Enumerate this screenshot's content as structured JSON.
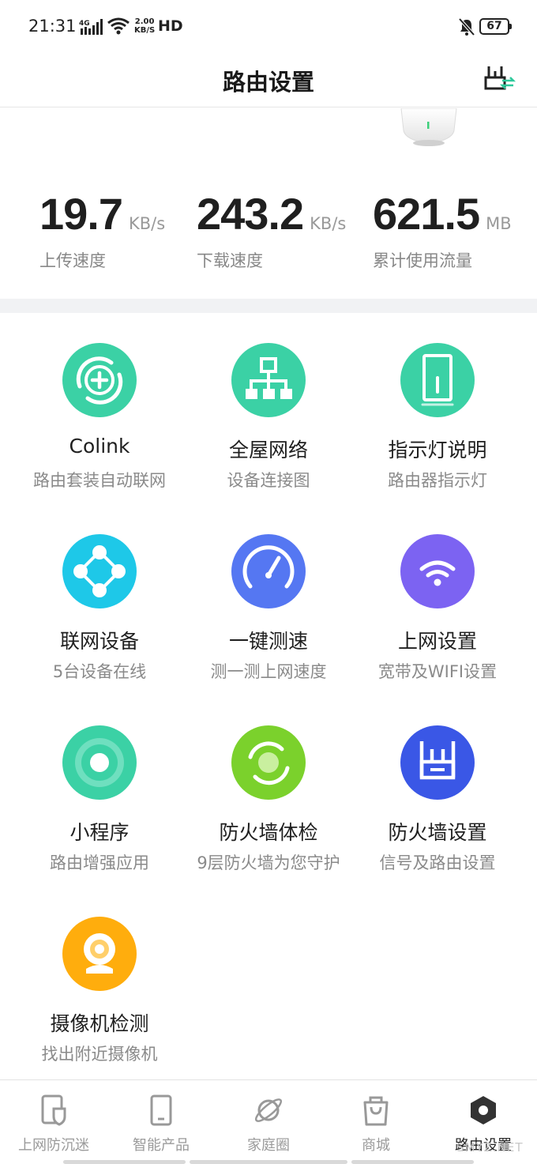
{
  "status_bar": {
    "time": "21:31",
    "network": "4G",
    "speed_value": "2.00",
    "speed_unit": "KB/S",
    "hd": "HD",
    "battery": "67"
  },
  "header": {
    "title": "路由设置"
  },
  "stats": [
    {
      "value": "19.7",
      "unit": "KB/s",
      "label": "上传速度"
    },
    {
      "value": "243.2",
      "unit": "KB/s",
      "label": "下载速度"
    },
    {
      "value": "621.5",
      "unit": "MB",
      "label": "累计使用流量"
    }
  ],
  "tiles": [
    {
      "title": "Colink",
      "subtitle": "路由套装自动联网",
      "icon": "colink-plus-icon",
      "color": "#3bd1a5"
    },
    {
      "title": "全屋网络",
      "subtitle": "设备连接图",
      "icon": "network-topology-icon",
      "color": "#3bd1a5"
    },
    {
      "title": "指示灯说明",
      "subtitle": "路由器指示灯",
      "icon": "router-light-icon",
      "color": "#3bd1a5"
    },
    {
      "title": "联网设备",
      "subtitle": "5台设备在线",
      "icon": "connected-devices-icon",
      "color": "#1ec8e8"
    },
    {
      "title": "一键测速",
      "subtitle": "测一测上网速度",
      "icon": "speedometer-icon",
      "color": "#5577f2"
    },
    {
      "title": "上网设置",
      "subtitle": "宽带及WIFI设置",
      "icon": "wifi-icon",
      "color": "#7c63f2"
    },
    {
      "title": "小程序",
      "subtitle": "路由增强应用",
      "icon": "mini-program-icon",
      "color": "#3bd1a5"
    },
    {
      "title": "防火墙体检",
      "subtitle": "9层防火墙为您守护",
      "icon": "firewall-check-icon",
      "color": "#7bd12c"
    },
    {
      "title": "防火墙设置",
      "subtitle": "信号及路由设置",
      "icon": "firewall-router-icon",
      "color": "#3a57e6"
    },
    {
      "title": "摄像机检测",
      "subtitle": "找出附近摄像机",
      "icon": "camera-icon",
      "color": "#ffad0d"
    }
  ],
  "nav": [
    {
      "label": "上网防沉迷",
      "icon": "shield-phone-icon"
    },
    {
      "label": "智能产品",
      "icon": "phone-device-icon"
    },
    {
      "label": "家庭圈",
      "icon": "planet-icon"
    },
    {
      "label": "商城",
      "icon": "shopping-bag-icon"
    },
    {
      "label": "路由设置",
      "icon": "router-hexagon-icon",
      "active": true
    }
  ],
  "watermark": "SMYZ.NET",
  "colors": {
    "accent": "#2ec99b",
    "text_primary": "#1f1f1f",
    "text_secondary": "#8a8a8a"
  }
}
